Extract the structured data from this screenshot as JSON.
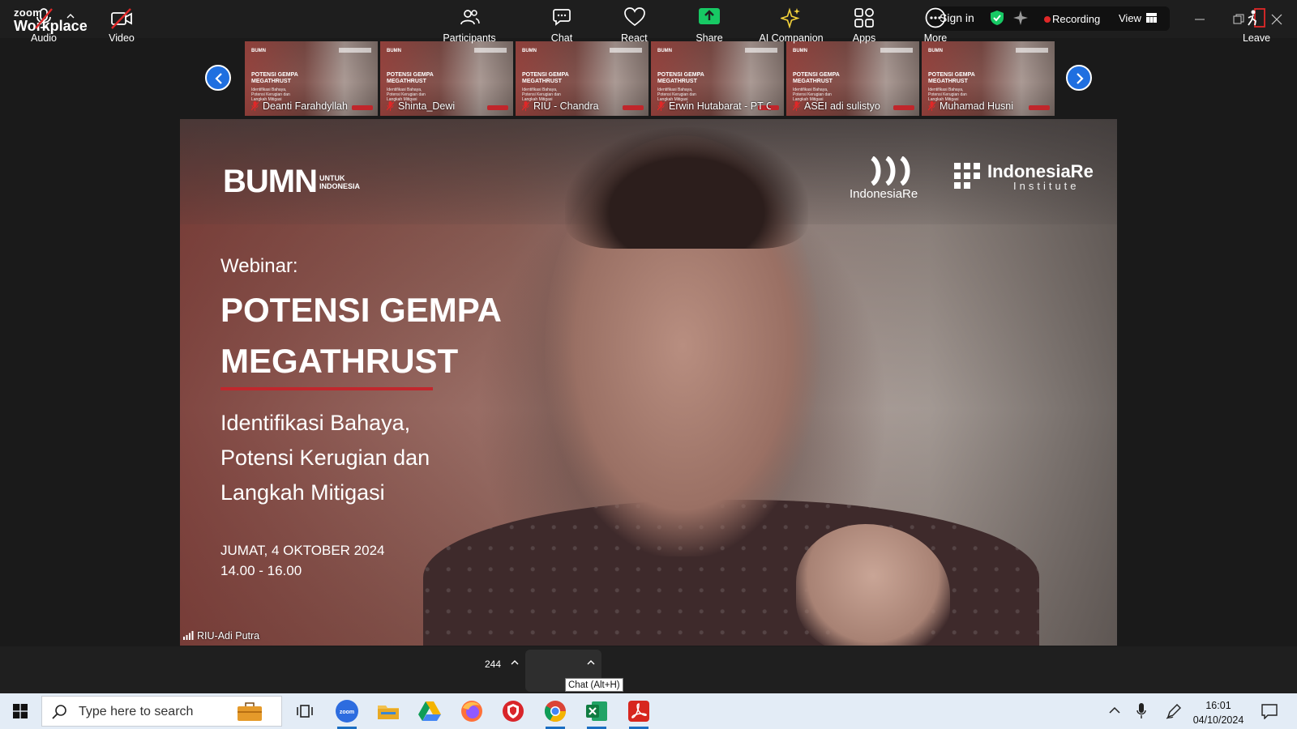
{
  "app": {
    "logo_line1": "zoom",
    "logo_line2": "Workplace"
  },
  "titlebar": {
    "sign_in": "Sign in",
    "recording": "Recording",
    "view": "View"
  },
  "filmstrip": {
    "thumb_kicker": "Webinar:",
    "thumb_title": "POTENSI GEMPA MEGATHRUST",
    "thumb_sub": "Identifikasi Bahaya, Potensi Kerugian dan Langkah Mitigasi",
    "participants": [
      {
        "name": "Deanti Farahdyllah"
      },
      {
        "name": "Shinta_Dewi"
      },
      {
        "name": "RIU - Chandra"
      },
      {
        "name": "Erwin Hutabarat - PT C..."
      },
      {
        "name": "ASEI adi sulistyo"
      },
      {
        "name": "Muhamad Husni"
      }
    ]
  },
  "stage": {
    "bumn_logo": "BUMN",
    "bumn_sub_1": "UNTUK",
    "bumn_sub_2": "INDONESIA",
    "ire_name": "IndonesiaRe",
    "iri_name": "IndonesiaRe",
    "iri_sub": "Institute",
    "kicker": "Webinar:",
    "title_1": "POTENSI GEMPA",
    "title_2": "MEGATHRUST",
    "sub_1": "Identifikasi Bahaya,",
    "sub_2": "Potensi Kerugian dan",
    "sub_3": "Langkah Mitigasi",
    "date": "JUMAT, 4 OKTOBER 2024",
    "time": "14.00 - 16.00",
    "speaker_name": "RIU-Adi Putra"
  },
  "toolbar": {
    "audio": "Audio",
    "video": "Video",
    "participants": "Participants",
    "participant_count": "244",
    "chat": "Chat",
    "chat_tooltip": "Chat (Alt+H)",
    "react": "React",
    "share": "Share",
    "ai_companion": "AI Companion",
    "apps": "Apps",
    "more": "More",
    "leave": "Leave"
  },
  "taskbar": {
    "search_placeholder": "Type here to search",
    "time": "16:01",
    "date": "04/10/2024"
  },
  "colors": {
    "accent_blue": "#1f6fe0",
    "recording_red": "#e02828",
    "share_green": "#17c964",
    "ai_yellow": "#f5d33b",
    "slide_red": "#c1272d"
  }
}
